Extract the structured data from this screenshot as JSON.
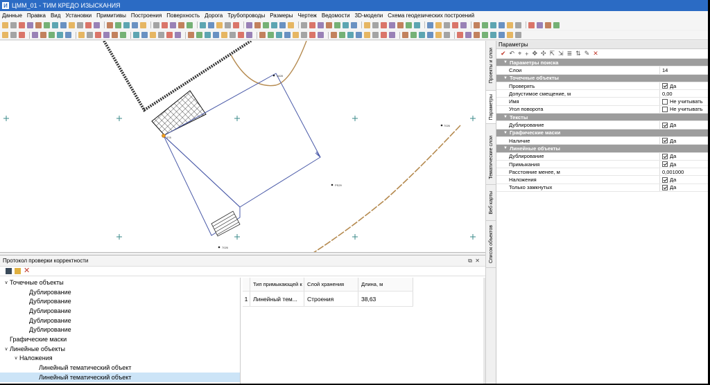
{
  "window": {
    "title": "ЦММ_01 - ТИМ КРЕДО ИЗЫСКАНИЯ",
    "logo": "И"
  },
  "menu": [
    "Данные",
    "Правка",
    "Вид",
    "Установки",
    "Примитивы",
    "Построения",
    "Поверхность",
    "Дорога",
    "Трубопроводы",
    "Размеры",
    "Чертеж",
    "Ведомости",
    "3D-модели",
    "Схема геодезических построений"
  ],
  "canvas": {
    "point_labels": {
      "p1": "1828",
      "p2": "378",
      "p3": "7026",
      "p4": "PS29",
      "p5": "7026"
    }
  },
  "side_tabs": [
    "Проекты и слои",
    "Параметры",
    "Тематические слои",
    "Веб карты",
    "Список объектов"
  ],
  "params": {
    "header": "Параметры",
    "groups": [
      {
        "title": "Параметры поиска",
        "rows": [
          {
            "name": "Слои",
            "value": "14"
          }
        ]
      },
      {
        "title": "Точечные объекты",
        "rows": [
          {
            "name": "Проверять",
            "value": "Да",
            "checked": true
          },
          {
            "name": "Допустимое смещение, м",
            "value": "0,00"
          },
          {
            "name": "Имя",
            "value": "Не учитывать",
            "checked": false
          },
          {
            "name": "Угол поворота",
            "value": "Не учитывать",
            "checked": false
          }
        ]
      },
      {
        "title": "Тексты",
        "rows": [
          {
            "name": "Дублирование",
            "value": "Да",
            "checked": true
          }
        ]
      },
      {
        "title": "Графические маски",
        "rows": [
          {
            "name": "Наличие",
            "value": "Да",
            "checked": true
          }
        ]
      },
      {
        "title": "Линейные объекты",
        "rows": [
          {
            "name": "Дублирование",
            "value": "Да",
            "checked": true
          },
          {
            "name": "Примыкания",
            "value": "Да",
            "checked": true
          },
          {
            "name": "Расстояние менее, м",
            "value": "0,001000"
          },
          {
            "name": "Наложения",
            "value": "Да",
            "checked": true
          },
          {
            "name": "Только замкнутых",
            "value": "Да",
            "checked": true
          }
        ]
      }
    ]
  },
  "protocol": {
    "title": "Протокол проверки корректности",
    "tree": [
      {
        "label": "Точечные объекты",
        "level": 0,
        "arrow": "∨"
      },
      {
        "label": "Дублирование",
        "level": 2
      },
      {
        "label": "Дублирование",
        "level": 2
      },
      {
        "label": "Дублирование",
        "level": 2
      },
      {
        "label": "Дублирование",
        "level": 2
      },
      {
        "label": "Дублирование",
        "level": 2
      },
      {
        "label": "Графические маски",
        "level": 0
      },
      {
        "label": "Линейные объекты",
        "level": 0,
        "arrow": "∨"
      },
      {
        "label": "Наложения",
        "level": 1,
        "arrow": "∨"
      },
      {
        "label": "Линейный тематический объект",
        "level": 3
      },
      {
        "label": "Линейный тематический объект",
        "level": 3,
        "selected": true
      }
    ],
    "grid": {
      "columns": [
        "Тип примыкающей к",
        "Слой хранения",
        "Длина, м"
      ],
      "rows": [
        {
          "num": "1",
          "type": "Линейный тем...",
          "layer": "Строения",
          "length": "38,63"
        }
      ]
    }
  }
}
